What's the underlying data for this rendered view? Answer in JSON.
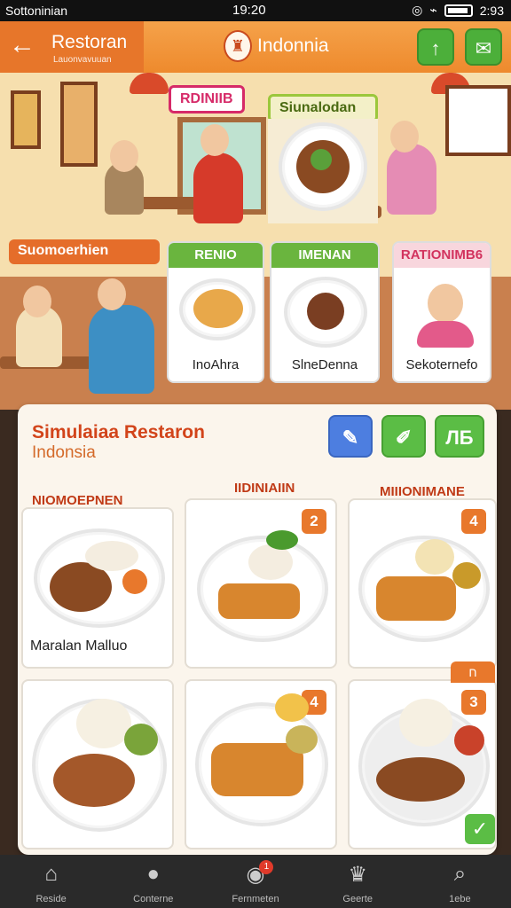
{
  "status_bar": {
    "carrier": "Sottoninian",
    "time": "19:20",
    "battery_text": "2:93"
  },
  "app_bar": {
    "back_title": "Restoran",
    "back_subtitle": "Lauonvavuuan",
    "brand_name": "Indonnia",
    "upload_icon": "arrow-up-icon",
    "chat_icon": "chat-bubble-icon"
  },
  "scene": {
    "sign_pink": "RDINIIB",
    "sign_green": "Siunalodan",
    "sign_left": "Suomoerhien",
    "cards": [
      {
        "header": "RENIO",
        "caption": "InoAhra",
        "color": "#6ab53e"
      },
      {
        "header": "IMENAN",
        "caption": "SlneDenna",
        "color": "#6ab53e"
      },
      {
        "header": "RATIONIMB6",
        "caption": "Sekoternefo",
        "color": "#d2335e"
      }
    ]
  },
  "panel": {
    "title": "Simulaiaa Restaron",
    "subtitle": "Indonsia",
    "tool_third_label": "ЛБ",
    "column_heads": [
      "NIOMOEPNEN",
      "IIDINIAIIN",
      "MIIIONIMANE"
    ],
    "dishes": [
      {
        "label": "",
        "caption": "Maralan Malluo",
        "badge": ""
      },
      {
        "label": "",
        "caption": "",
        "badge": "2"
      },
      {
        "label": "",
        "caption": "",
        "badge": "4"
      },
      {
        "label": "",
        "caption": "",
        "badge": ""
      },
      {
        "label": "",
        "caption": "",
        "badge": "4"
      },
      {
        "label": "",
        "caption": "",
        "badge": "3"
      }
    ],
    "corner_tab": "ח"
  },
  "bottom_nav": [
    {
      "label": "Reside",
      "icon": "home-icon"
    },
    {
      "label": "Conterne",
      "icon": "person-icon"
    },
    {
      "label": "Fernmeten",
      "icon": "palette-icon",
      "badge": "1"
    },
    {
      "label": "Geerte",
      "icon": "chef-hat-icon"
    },
    {
      "label": "1ebe",
      "icon": "search-icon"
    }
  ],
  "colors": {
    "primary": "#ee8a2d",
    "accent_green": "#5bbd45",
    "accent_blue": "#4d7ee0",
    "title_red": "#d2441a"
  }
}
